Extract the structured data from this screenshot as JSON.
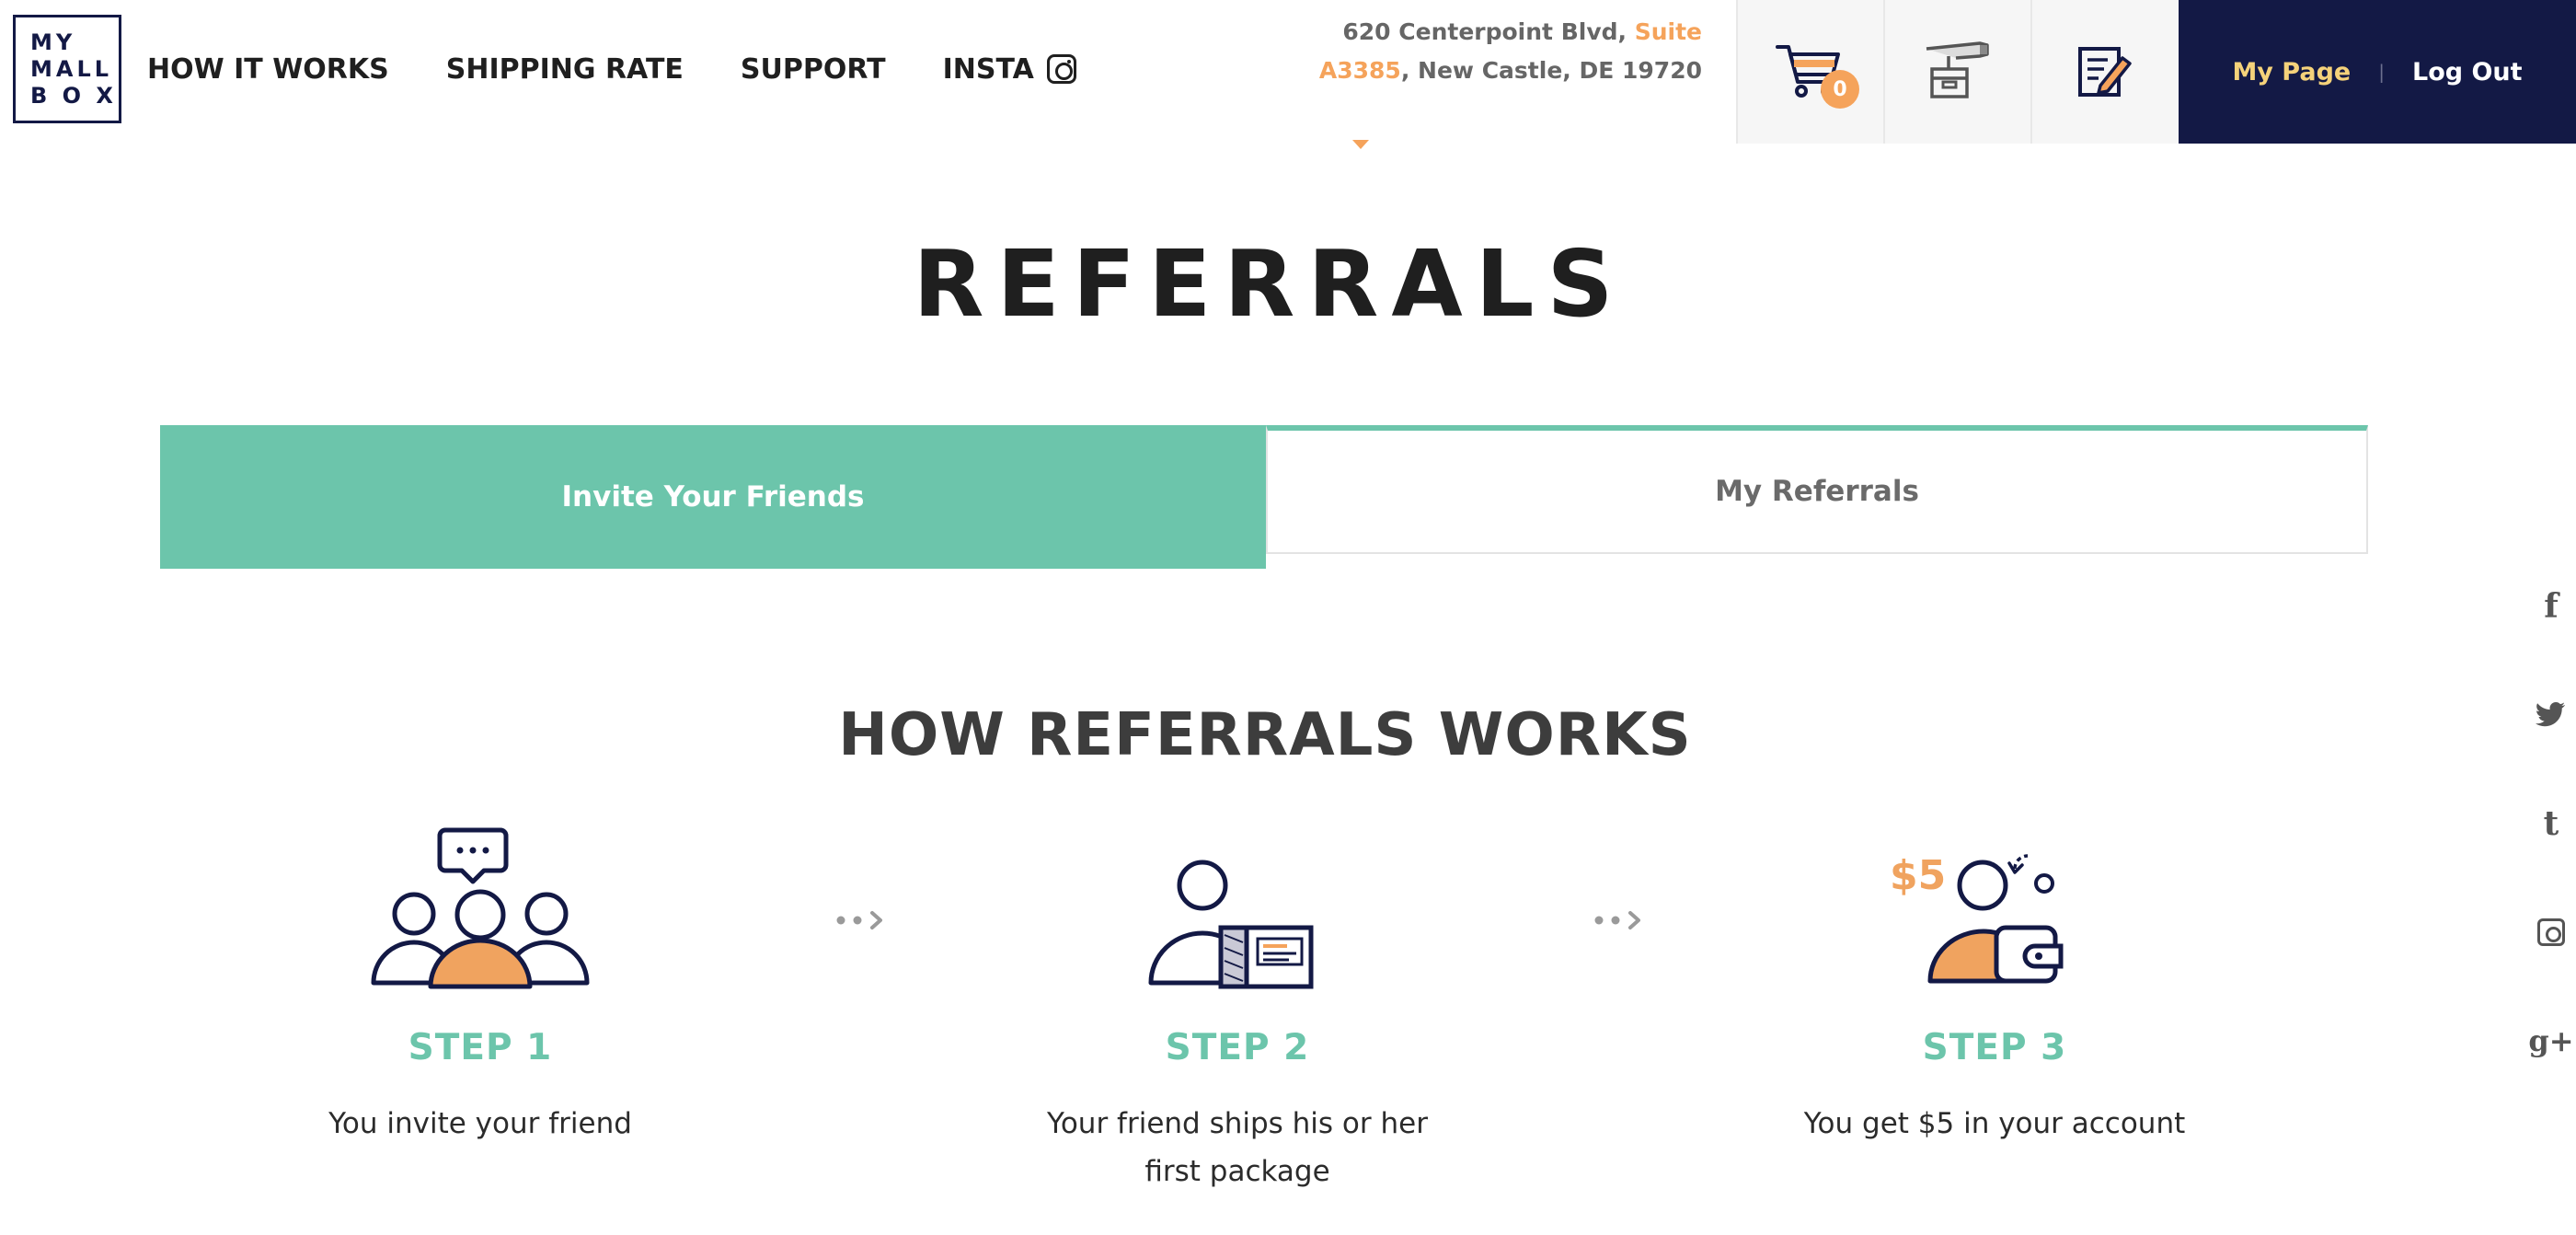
{
  "logo": {
    "line1": "MY",
    "line2": "MALL",
    "line3": "B O X"
  },
  "nav": {
    "items": [
      {
        "label": "HOW IT WORKS"
      },
      {
        "label": "SHIPPING RATE"
      },
      {
        "label": "SUPPORT"
      },
      {
        "label": "INSTA"
      }
    ]
  },
  "address": {
    "part1": "620 Centerpoint Blvd, ",
    "suite_a": "Suite",
    "suite_b": "A3385",
    "part2": ", New Castle, DE 19720"
  },
  "header_icons": [
    {
      "icon": "cart-icon",
      "badge": "0"
    },
    {
      "icon": "package-hand-icon"
    },
    {
      "icon": "form-edit-icon"
    }
  ],
  "account": {
    "my_page": "My Page",
    "separator": "|",
    "logout": "Log Out"
  },
  "page_title": "REFERRALS",
  "tabs": [
    {
      "label": "Invite Your Friends",
      "active": true
    },
    {
      "label": "My Referrals",
      "active": false
    }
  ],
  "section_title": "HOW REFERRALS WORKS",
  "steps": [
    {
      "label": "STEP 1",
      "desc_line1": "You invite your friend",
      "desc_line2": "",
      "icon": "group-chat-icon"
    },
    {
      "label": "STEP 2",
      "desc_line1": "Your friend ships his or her",
      "desc_line2": "first package",
      "icon": "person-package-icon"
    },
    {
      "label": "STEP 3",
      "desc_line1": "You get $5 in your account",
      "desc_line2": "",
      "icon": "person-wallet-icon",
      "badge": "$5"
    }
  ],
  "social": [
    {
      "icon": "facebook-icon",
      "glyph": "f"
    },
    {
      "icon": "twitter-icon",
      "glyph": ""
    },
    {
      "icon": "tumblr-icon",
      "glyph": "t"
    },
    {
      "icon": "instagram-icon",
      "glyph": ""
    },
    {
      "icon": "google-plus-icon",
      "glyph": "g+"
    }
  ],
  "colors": {
    "navy": "#131945",
    "teal": "#6cc5ab",
    "orange": "#f5a35b",
    "yellow": "#f5d27a"
  }
}
